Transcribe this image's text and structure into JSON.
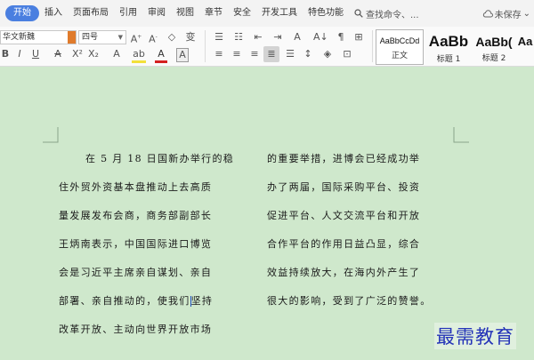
{
  "menubar": {
    "tabs": [
      "开始",
      "插入",
      "页面布局",
      "引用",
      "审阅",
      "视图",
      "章节",
      "安全",
      "开发工具",
      "特色功能"
    ],
    "search_label": "查找命令、...",
    "save_status": "未保存",
    "more": "⌄"
  },
  "ribbon": {
    "font_name": "华文新魏",
    "font_size": "四号",
    "styles": [
      {
        "sample": "AaBbCcDd",
        "name": "正文"
      },
      {
        "sample": "AaBb",
        "name": "标题 1"
      },
      {
        "sample": "AaBb(",
        "name": "标题 2"
      },
      {
        "sample": "Aa",
        "name": ""
      }
    ]
  },
  "document": {
    "left_column": [
      "在 5 月 18 日国新办举行的稳",
      "住外贸外资基本盘推动上去高质",
      "量发展发布会商，商务部副部长",
      "王炳南表示，中国国际进口博览",
      "会是习近平主席亲自谋划、亲自",
      "部署、亲自推动的，使我们",
      "坚持",
      "改革开放、主动向世界开放市场"
    ],
    "right_column": [
      "的重要举措，进博会已经成功举",
      "办了两届，国际采购平台、投资",
      "促进平台、人文交流平台和开放",
      "合作平台的作用日益凸显，综合",
      "效益持续放大，在海内外产生了",
      "很大的影响，受到了广泛的赞誉。"
    ],
    "watermark": "最需教育"
  },
  "colors": {
    "accent": "#4a7fe0",
    "page_bg": "#cfe8cc",
    "watermark": "#2433b8"
  }
}
